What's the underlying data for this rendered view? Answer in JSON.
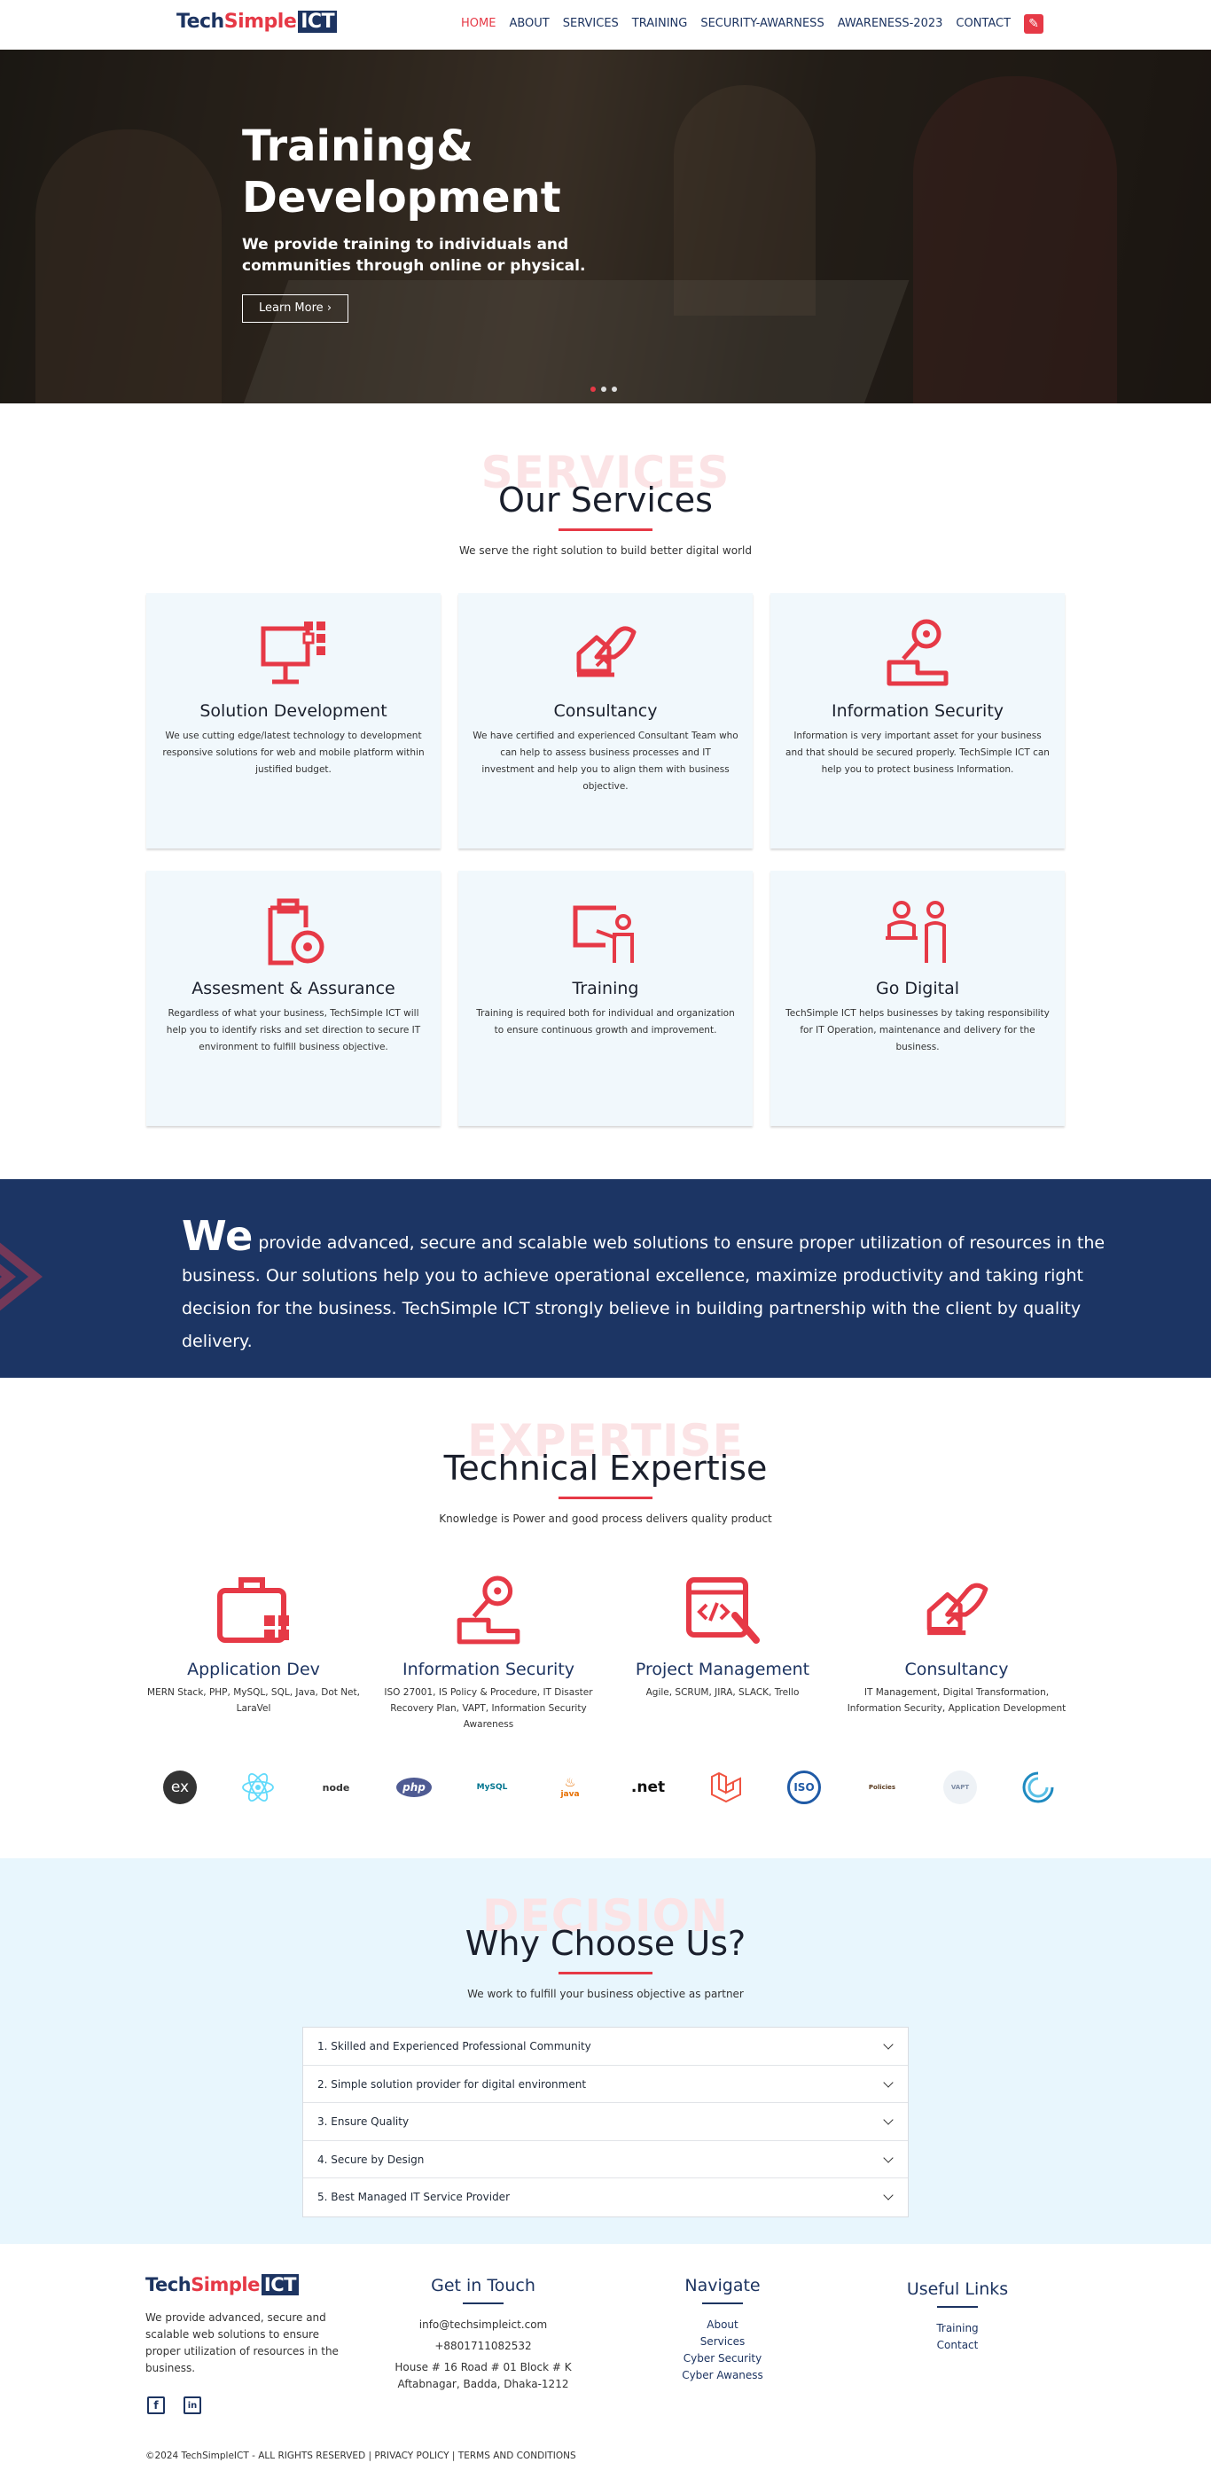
{
  "nav": {
    "logo": {
      "part1": "Tech",
      "part2": "Simple",
      "part3": "ICT"
    },
    "items": [
      "HOME",
      "ABOUT",
      "SERVICES",
      "TRAINING",
      "SECURITY-AWARNESS",
      "AWARENESS-2023",
      "CONTACT"
    ],
    "active": "HOME"
  },
  "hero": {
    "title": "Training& Development",
    "subtitle": "We provide training to individuals and communities through online or physical.",
    "button": "Learn More",
    "slides": 3,
    "active_slide": 1
  },
  "services": {
    "ghost": "SERVICES",
    "title": "Our Services",
    "subtitle": "We serve the right solution to build better digital world",
    "cards": [
      {
        "icon": "monitor-icon",
        "title": "Solution Development",
        "text": "We use cutting edge/latest technology to development responsive solutions for web and mobile platform within justified budget."
      },
      {
        "icon": "consultancy-icon",
        "title": "Consultancy",
        "text": "We have certified and experienced Consultant Team who can help to assess business processes and IT investment and help you to align them with business objective."
      },
      {
        "icon": "key-lock-icon",
        "title": "Information Security",
        "text": "Information is very important asset for your business and that should be secured properly. TechSimple ICT can help you to protect business Information."
      },
      {
        "icon": "clipboard-icon",
        "title": "Assesment & Assurance",
        "text": "Regardless of what your business, TechSimple ICT will help you to identify risks and set direction to secure IT environment to fulfill business objective."
      },
      {
        "icon": "training-board-icon",
        "title": "Training",
        "text": "Training is required both for individual and organization to ensure continuous growth and improvement."
      },
      {
        "icon": "people-icon",
        "title": "Go Digital",
        "text": "TechSimple ICT helps businesses by taking responsibility for IT Operation, maintenance and delivery for the business."
      }
    ]
  },
  "banner": {
    "lead": "We",
    "text": " provide advanced, secure and scalable web solutions to ensure proper utilization of resources in the business. Our solutions help you to achieve operational excellence, maximize productivity and taking right decision for the business. TechSimple ICT strongly believe in building partnership with the client by quality delivery."
  },
  "expertise": {
    "ghost": "EXPERTISE",
    "title": "Technical Expertise",
    "subtitle": "Knowledge is Power and good process delivers quality product",
    "items": [
      {
        "icon": "briefcase-icon",
        "title": "Application Dev",
        "text": "MERN Stack, PHP, MySQL, SQL, Java, Dot Net, LaraVel"
      },
      {
        "icon": "key-lock-icon",
        "title": "Information Security",
        "text": "ISO 27001, IS Policy & Procedure, IT Disaster Recovery Plan, VAPT, Information Security Awareness"
      },
      {
        "icon": "code-wrench-icon",
        "title": "Project Management",
        "text": "Agile, SCRUM, JIRA, SLACK, Trello"
      },
      {
        "icon": "consultancy-icon",
        "title": "Consultancy",
        "text": "IT Management, Digital Transformation, Information Security, Application Development"
      }
    ],
    "tech_logos": [
      "ex",
      "react",
      "node",
      "php",
      "MySQL",
      "java",
      ".net",
      "laravel",
      "ISO",
      "Policies",
      "VAPT",
      "cloud"
    ]
  },
  "why": {
    "ghost": "DECISION",
    "title": "Why Choose Us?",
    "subtitle": "We work to fulfill your business objective as partner",
    "items": [
      "1. Skilled and Experienced Professional Community",
      "2. Simple solution provider for digital environment",
      "3. Ensure Quality",
      "4. Secure by Design",
      "5. Best Managed IT Service Provider"
    ]
  },
  "footer": {
    "about": "We provide advanced, secure and scalable web solutions to ensure proper utilization of resources in the business.",
    "get_in_touch": {
      "title": "Get in Touch",
      "email": "info@techsimpleict.com",
      "phone": "+8801711082532",
      "address1": "House # 16 Road # 01 Block # K",
      "address2": "Aftabnagar, Badda, Dhaka-1212"
    },
    "navigate": {
      "title": "Navigate",
      "links": [
        "About",
        "Services",
        "Cyber Security",
        "Cyber Awaness"
      ]
    },
    "useful": {
      "title": "Useful Links",
      "links": [
        "Training",
        "Contact"
      ]
    },
    "copyright": "©2024 TechSimpleICT - ALL RIGHTS RESERVED | PRIVACY POLICY | TERMS AND CONDITIONS"
  },
  "colors": {
    "brand_red": "#e63946",
    "brand_navy": "#1d3461",
    "banner_bg": "#1c3564",
    "card_bg": "#f1f8fc",
    "why_bg": "#e8f6fd"
  }
}
